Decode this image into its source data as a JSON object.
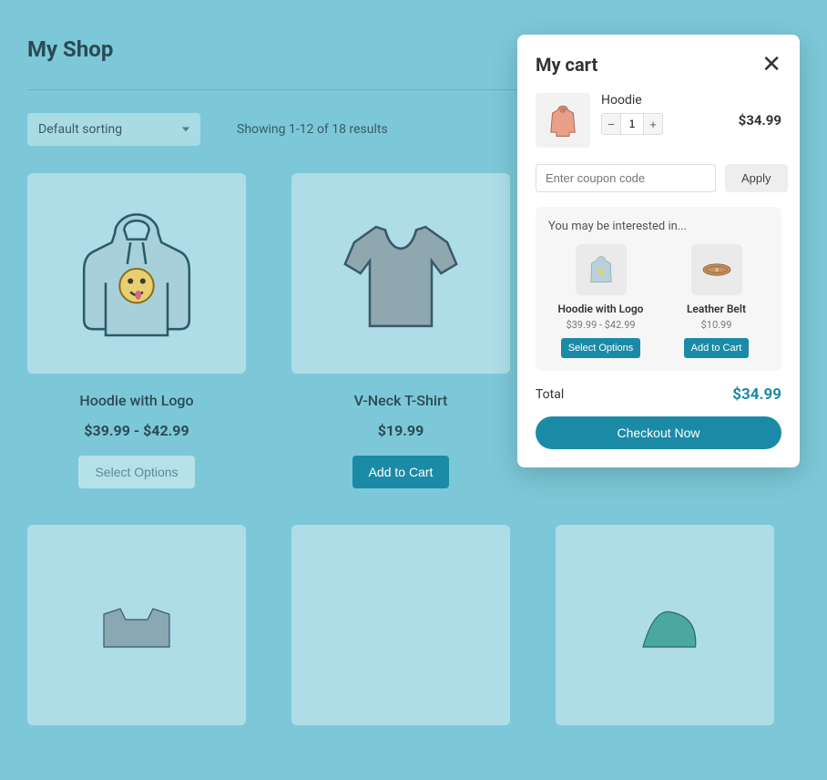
{
  "shop": {
    "title": "My Shop",
    "sort_label": "Default sorting",
    "results_text": "Showing 1-12 of 18 results",
    "products": [
      {
        "name": "Hoodie with Logo",
        "price": "$39.99 - $42.99",
        "cta": "Select Options",
        "cta_style": "muted"
      },
      {
        "name": "V-Neck T-Shirt",
        "price": "$19.99",
        "cta": "Add to Cart",
        "cta_style": "primary"
      }
    ]
  },
  "cart": {
    "title": "My cart",
    "item": {
      "name": "Hoodie",
      "qty": "1",
      "price": "$34.99"
    },
    "coupon_placeholder": "Enter coupon code",
    "apply_label": "Apply",
    "upsell_title": "You may be interested in...",
    "upsell": [
      {
        "name": "Hoodie with Logo",
        "price": "$39.99 - $42.99",
        "cta": "Select Options"
      },
      {
        "name": "Leather Belt",
        "price": "$10.99",
        "cta": "Add to Cart"
      }
    ],
    "total_label": "Total",
    "total_value": "$34.99",
    "checkout_label": "Checkout Now"
  }
}
